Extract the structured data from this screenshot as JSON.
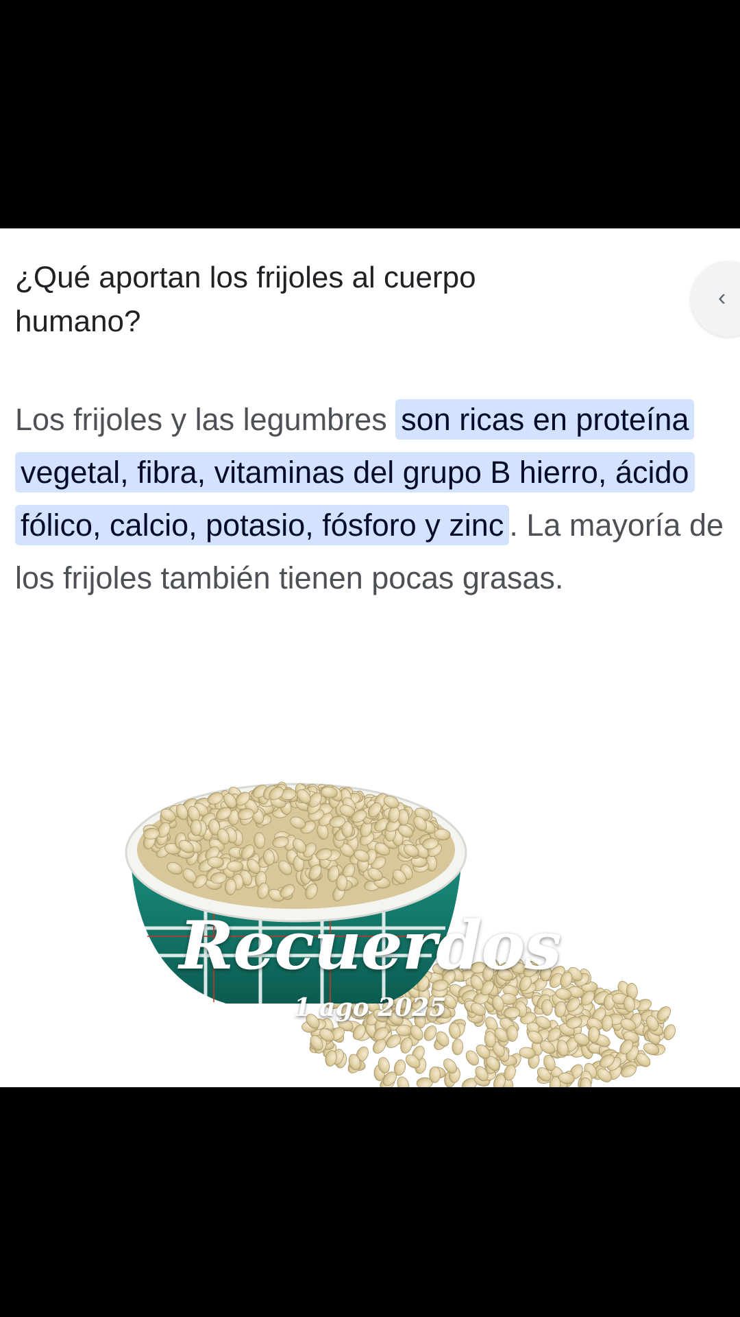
{
  "question": "¿Qué aportan los frijoles al cuerpo humano?",
  "answer": {
    "intro": "Los frijoles y las legumbres ",
    "highlight": "son ricas en proteína vegetal, fibra, vitaminas del grupo B hierro, ácido fólico, calcio, potasio, fósforo y zinc",
    "rest": ". La mayoría de los frijoles también tienen pocas grasas."
  },
  "overlay": {
    "title": "Recuerdos",
    "date": "1 ago 2025"
  },
  "icons": {
    "side_button": "chevron-left-icon",
    "image": "bowl-of-beans-image"
  },
  "colors": {
    "highlight_bg": "#d3e3fd",
    "bowl_teal": "#16806f",
    "bean": "#e3d6ad"
  }
}
